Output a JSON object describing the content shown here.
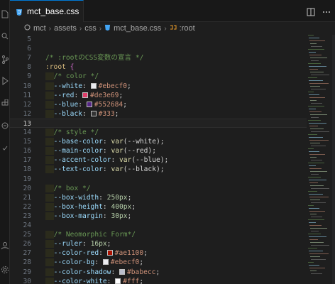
{
  "tab": {
    "label": "mct_base.css",
    "icon": "css-file-icon"
  },
  "breadcrumb": [
    {
      "label": "mct",
      "icon": "folder-icon"
    },
    {
      "label": "assets"
    },
    {
      "label": "css"
    },
    {
      "label": "mct_base.css",
      "icon": "css-file-icon"
    },
    {
      "label": ":root",
      "icon": "symbol-class-icon"
    }
  ],
  "current_line": 13,
  "lines": [
    {
      "n": "5",
      "tokens": []
    },
    {
      "n": "6",
      "tokens": []
    },
    {
      "n": "7",
      "tokens": [
        {
          "t": "/* :rootのCSS変数の宣言 */",
          "c": "comment"
        }
      ]
    },
    {
      "n": "8",
      "tokens": [
        {
          "t": ":root",
          "c": "sel"
        },
        {
          "t": " ",
          "c": "plain"
        },
        {
          "t": "{",
          "c": "brace"
        }
      ]
    },
    {
      "n": "9",
      "tokens": [
        {
          "t": "  ",
          "c": "indent"
        },
        {
          "t": "/* color */",
          "c": "comment"
        }
      ]
    },
    {
      "n": "10",
      "tokens": [
        {
          "t": "  ",
          "c": "indent"
        },
        {
          "t": "--white",
          "c": "prop"
        },
        {
          "t": ": ",
          "c": "plain"
        },
        {
          "swatch": "#ebecf0"
        },
        {
          "t": "#ebecf0",
          "c": "val"
        },
        {
          "t": ";",
          "c": "plain"
        }
      ]
    },
    {
      "n": "11",
      "tokens": [
        {
          "t": "  ",
          "c": "indent"
        },
        {
          "t": "--red",
          "c": "prop"
        },
        {
          "t": ": ",
          "c": "plain"
        },
        {
          "swatch": "#de3e69"
        },
        {
          "t": "#de3e69",
          "c": "val"
        },
        {
          "t": ";",
          "c": "plain"
        }
      ]
    },
    {
      "n": "12",
      "tokens": [
        {
          "t": "  ",
          "c": "indent"
        },
        {
          "t": "--blue",
          "c": "prop"
        },
        {
          "t": ": ",
          "c": "plain"
        },
        {
          "swatch": "#552684"
        },
        {
          "t": "#552684",
          "c": "val"
        },
        {
          "t": ";",
          "c": "plain"
        }
      ]
    },
    {
      "n": "12",
      "tokens": [
        {
          "t": "  ",
          "c": "indent"
        },
        {
          "t": "--black",
          "c": "prop"
        },
        {
          "t": ": ",
          "c": "plain"
        },
        {
          "swatch": "#333"
        },
        {
          "t": "#333",
          "c": "val"
        },
        {
          "t": ";",
          "c": "plain"
        }
      ]
    },
    {
      "n": "13",
      "tokens": []
    },
    {
      "n": "14",
      "tokens": [
        {
          "t": "  ",
          "c": "indent"
        },
        {
          "t": "/* style */",
          "c": "comment"
        }
      ]
    },
    {
      "n": "15",
      "tokens": [
        {
          "t": "  ",
          "c": "indent"
        },
        {
          "t": "--base-color",
          "c": "prop"
        },
        {
          "t": ": ",
          "c": "plain"
        },
        {
          "t": "var",
          "c": "fn"
        },
        {
          "t": "(--white);",
          "c": "plain"
        }
      ]
    },
    {
      "n": "16",
      "tokens": [
        {
          "t": "  ",
          "c": "indent"
        },
        {
          "t": "--main-color",
          "c": "prop"
        },
        {
          "t": ": ",
          "c": "plain"
        },
        {
          "t": "var",
          "c": "fn"
        },
        {
          "t": "(--red);",
          "c": "plain"
        }
      ]
    },
    {
      "n": "17",
      "tokens": [
        {
          "t": "  ",
          "c": "indent"
        },
        {
          "t": "--accent-color",
          "c": "prop"
        },
        {
          "t": ": ",
          "c": "plain"
        },
        {
          "t": "var",
          "c": "fn"
        },
        {
          "t": "(--blue);",
          "c": "plain"
        }
      ]
    },
    {
      "n": "18",
      "tokens": [
        {
          "t": "  ",
          "c": "indent"
        },
        {
          "t": "--text-color",
          "c": "prop"
        },
        {
          "t": ": ",
          "c": "plain"
        },
        {
          "t": "var",
          "c": "fn"
        },
        {
          "t": "(--black);",
          "c": "plain"
        }
      ]
    },
    {
      "n": "19",
      "tokens": []
    },
    {
      "n": "20",
      "tokens": [
        {
          "t": "  ",
          "c": "indent"
        },
        {
          "t": "/* box */",
          "c": "comment"
        }
      ]
    },
    {
      "n": "21",
      "tokens": [
        {
          "t": "  ",
          "c": "indent"
        },
        {
          "t": "--box-width",
          "c": "prop"
        },
        {
          "t": ": ",
          "c": "plain"
        },
        {
          "t": "250px",
          "c": "num"
        },
        {
          "t": ";",
          "c": "plain"
        }
      ]
    },
    {
      "n": "22",
      "tokens": [
        {
          "t": "  ",
          "c": "indent"
        },
        {
          "t": "--box-height",
          "c": "prop"
        },
        {
          "t": ": ",
          "c": "plain"
        },
        {
          "t": "400px",
          "c": "num"
        },
        {
          "t": ";",
          "c": "plain"
        }
      ]
    },
    {
      "n": "23",
      "tokens": [
        {
          "t": "  ",
          "c": "indent"
        },
        {
          "t": "--box-margin",
          "c": "prop"
        },
        {
          "t": ": ",
          "c": "plain"
        },
        {
          "t": "30px",
          "c": "num"
        },
        {
          "t": ";",
          "c": "plain"
        }
      ]
    },
    {
      "n": "24",
      "tokens": []
    },
    {
      "n": "25",
      "tokens": [
        {
          "t": "  ",
          "c": "indent"
        },
        {
          "t": "/* Neomorphic Form*/",
          "c": "comment"
        }
      ]
    },
    {
      "n": "26",
      "tokens": [
        {
          "t": "  ",
          "c": "indent"
        },
        {
          "t": "--ruler",
          "c": "prop"
        },
        {
          "t": ": ",
          "c": "plain"
        },
        {
          "t": "16px",
          "c": "num"
        },
        {
          "t": ";",
          "c": "plain"
        }
      ]
    },
    {
      "n": "27",
      "tokens": [
        {
          "t": "  ",
          "c": "indent"
        },
        {
          "t": "--color-red",
          "c": "prop"
        },
        {
          "t": ": ",
          "c": "plain"
        },
        {
          "swatch": "#ae1100"
        },
        {
          "t": "#ae1100",
          "c": "val"
        },
        {
          "t": ";",
          "c": "plain"
        }
      ]
    },
    {
      "n": "28",
      "tokens": [
        {
          "t": "  ",
          "c": "indent"
        },
        {
          "t": "--color-bg",
          "c": "prop"
        },
        {
          "t": ": ",
          "c": "plain"
        },
        {
          "swatch": "#ebecf0"
        },
        {
          "t": "#ebecf0",
          "c": "val"
        },
        {
          "t": ";",
          "c": "plain"
        }
      ]
    },
    {
      "n": "29",
      "tokens": [
        {
          "t": "  ",
          "c": "indent"
        },
        {
          "t": "--color-shadow",
          "c": "prop"
        },
        {
          "t": ": ",
          "c": "plain"
        },
        {
          "swatch": "#babecc"
        },
        {
          "t": "#babecc",
          "c": "val"
        },
        {
          "t": ";",
          "c": "plain"
        }
      ]
    },
    {
      "n": "30",
      "tokens": [
        {
          "t": "  ",
          "c": "indent"
        },
        {
          "t": "--color-white",
          "c": "prop"
        },
        {
          "t": ": ",
          "c": "plain"
        },
        {
          "swatch": "#fff"
        },
        {
          "t": "#fff",
          "c": "val"
        },
        {
          "t": ";",
          "c": "plain"
        }
      ]
    },
    {
      "n": "31",
      "tokens": [
        {
          "t": "}",
          "c": "brace"
        }
      ]
    }
  ],
  "colors": {
    "accent": "#0078d4",
    "editor_bg": "#1e1e1e",
    "comment": "#6a9955",
    "property": "#9cdcfe",
    "selector": "#d7ba7d",
    "value": "#ce9178",
    "number": "#b5cea8",
    "function": "#dcdcaa"
  },
  "activity_icons": [
    "explorer-icon",
    "search-icon",
    "source-control-icon",
    "run-debug-icon",
    "extensions-icon",
    "remote-icon",
    "testing-icon",
    "account-icon",
    "settings-gear-icon"
  ],
  "editor_actions": [
    "split-editor-icon",
    "more-actions-icon"
  ]
}
